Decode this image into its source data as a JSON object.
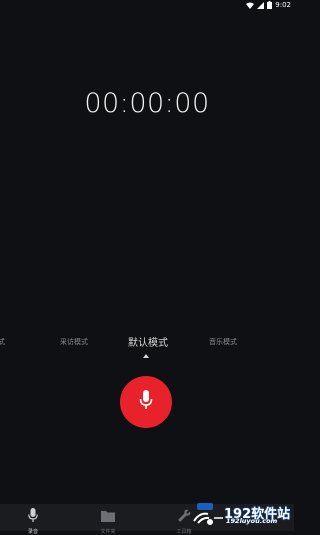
{
  "status_bar": {
    "time": "9:02"
  },
  "recorder": {
    "timer": "00:00:00",
    "modes": {
      "edge": "式",
      "interview": "采访模式",
      "default": "默认模式",
      "music": "音乐模式"
    },
    "selected_mode": "默认模式",
    "record_button_color": "#e8222a"
  },
  "bottom_nav": {
    "items": [
      {
        "label": "录音",
        "icon": "microphone-icon",
        "active": true
      },
      {
        "label": "文件夹",
        "icon": "folder-icon",
        "active": false
      },
      {
        "label": "工具箱",
        "icon": "wrench-icon",
        "active": false
      }
    ]
  },
  "watermark": {
    "text": "192软件站",
    "url": "192luyou.com"
  },
  "colors": {
    "background": "#0f1013",
    "accent": "#e8222a",
    "nav_background": "#1b1c1f"
  }
}
